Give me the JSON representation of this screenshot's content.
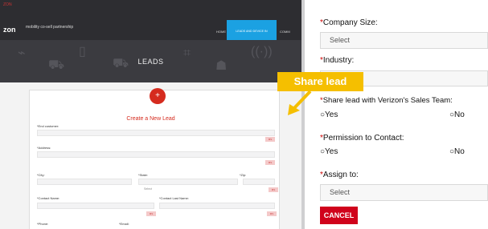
{
  "left": {
    "brand_top": "ZON",
    "brand_name": "zon",
    "brand_sub": "mobility co-sell partnership",
    "nav": {
      "home": "HOME",
      "active": "LEADS AND DEVICE IN MANAGEMENT",
      "comm": "COMM"
    },
    "hero_title": "LEADS",
    "form_title": "Create a New Lead",
    "labels": {
      "end_customer": "*End customer:",
      "address": "*Address:",
      "city": "*City:",
      "state": "*State:",
      "zip": "*Zip:",
      "contact_name": "*Contact Name:",
      "contact_last": "*Contact Last Name:",
      "phone": "*Phone:",
      "email": "*Email:"
    },
    "state_select": "Select",
    "tag": "MS"
  },
  "right": {
    "company_size_label": "Company Size:",
    "company_size_value": "Select",
    "industry_label": "Industry:",
    "share_label": "Share lead with Verizon's Sales Team:",
    "share_yes": "Yes",
    "share_no": "No",
    "permission_label": "Permission to Contact:",
    "permission_yes": "Yes",
    "permission_no": "No",
    "assign_label": "Assign to:",
    "assign_value": "Select",
    "cancel": "CANCEL",
    "required_mark": "*"
  },
  "callout": "Share lead",
  "colors": {
    "accent": "#d0021b",
    "callout": "#f5bf00",
    "nav_active": "#1ba1e2"
  }
}
